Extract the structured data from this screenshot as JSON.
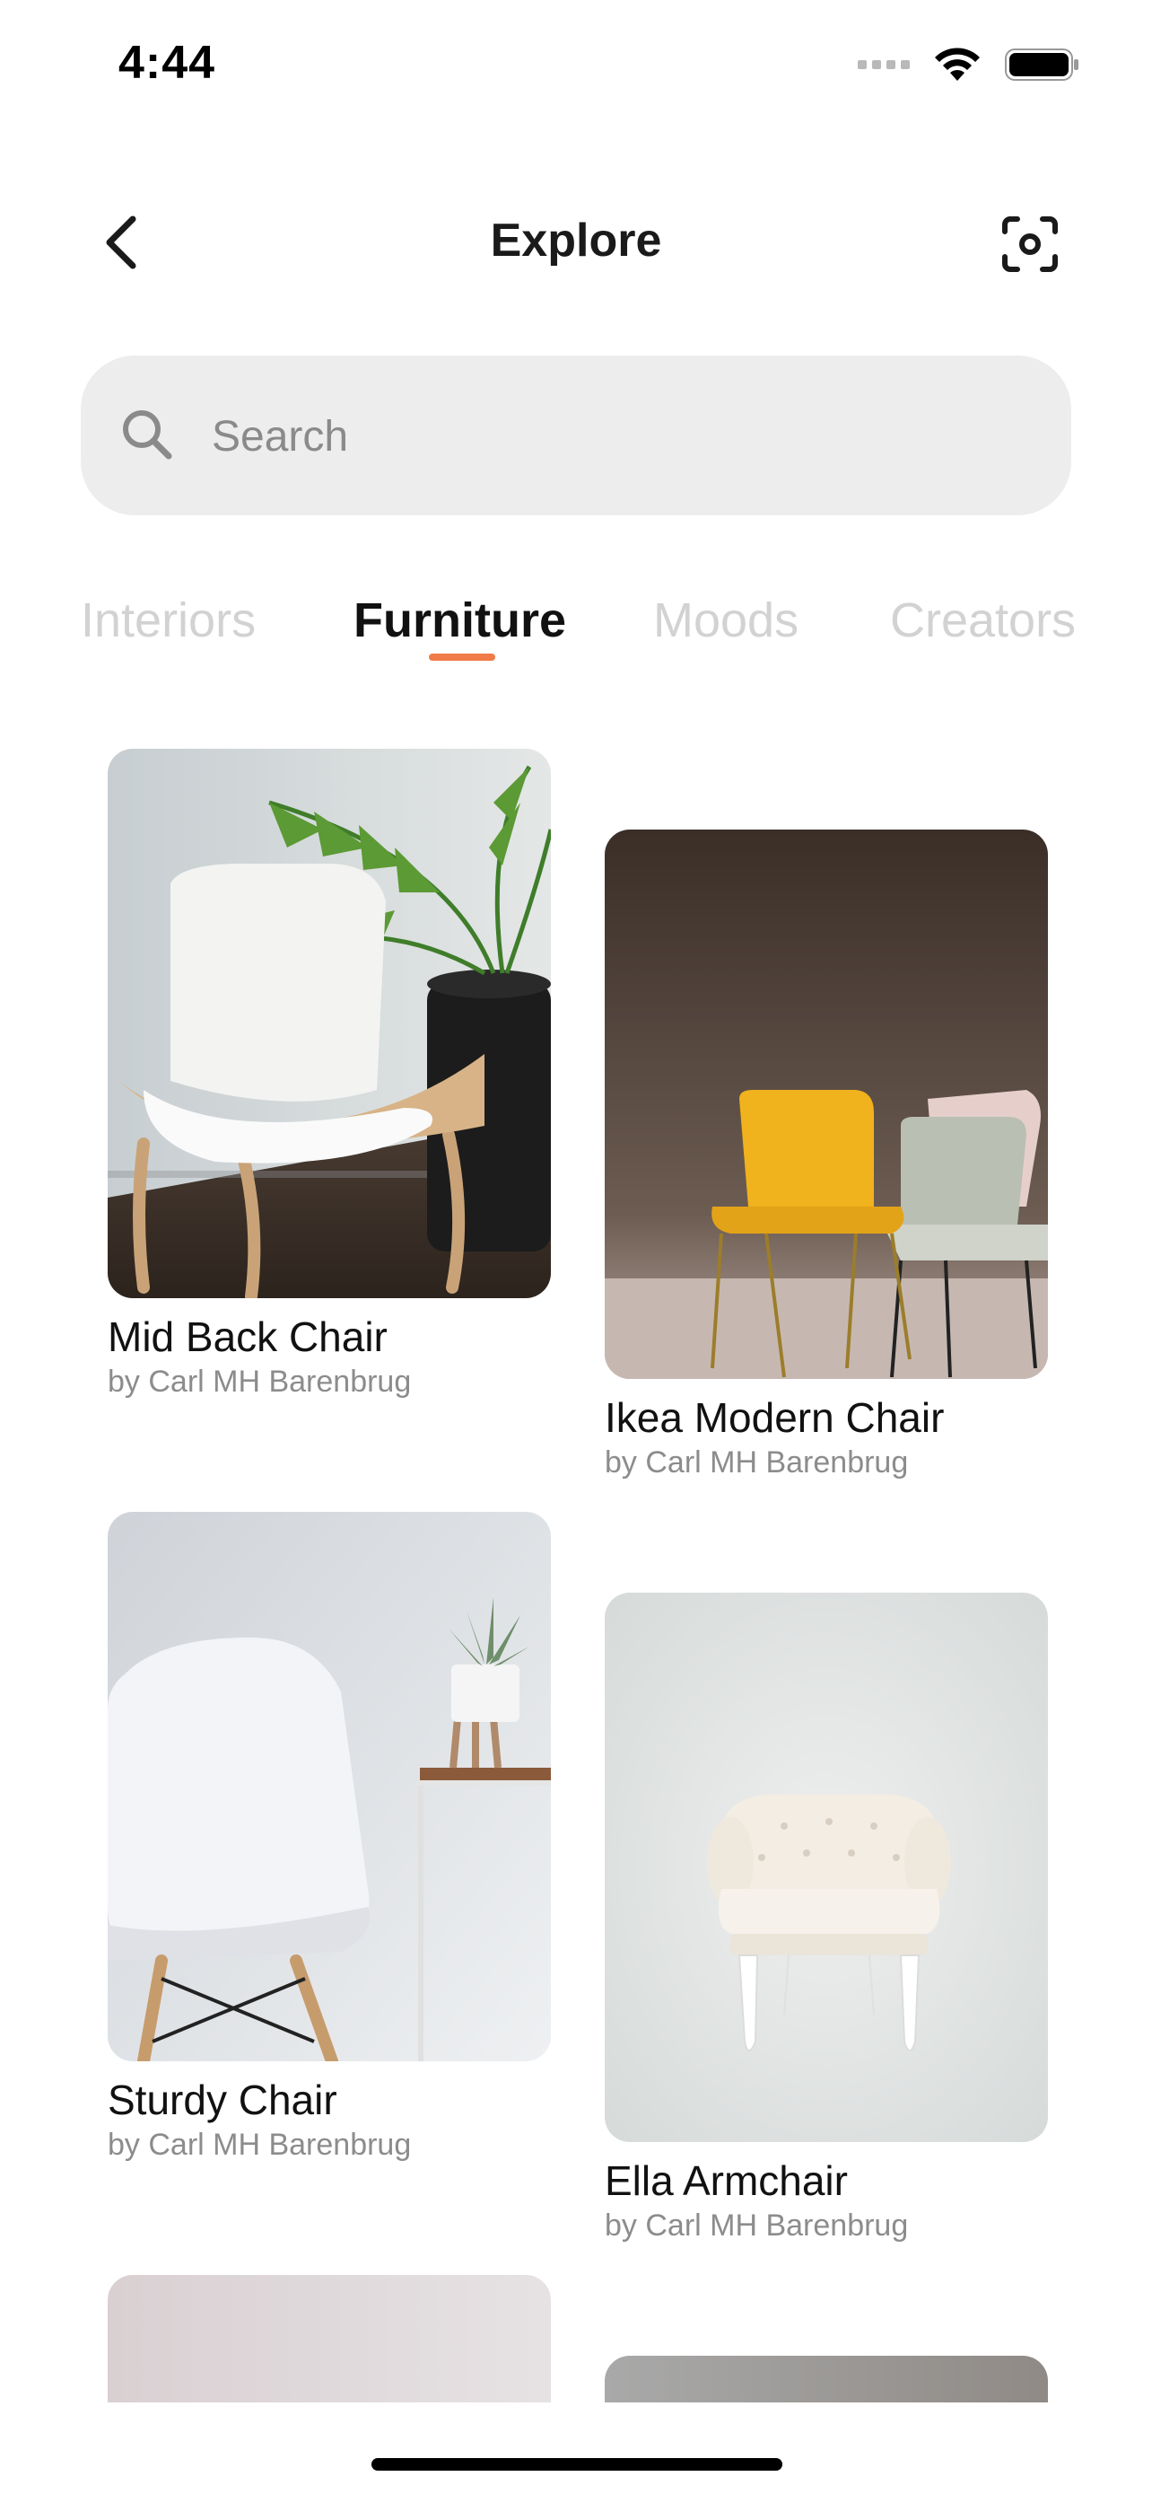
{
  "status_bar": {
    "time": "4:44",
    "icons": [
      "cellular-dots-icon",
      "wifi-icon",
      "battery-icon"
    ]
  },
  "header": {
    "title": "Explore",
    "back_icon": "chevron-left-icon",
    "scan_icon": "camera-scan-icon"
  },
  "search": {
    "placeholder": "Search",
    "value": "",
    "icon": "search-icon"
  },
  "tabs": [
    {
      "label": "Interiors",
      "active": false
    },
    {
      "label": "Furniture",
      "active": true
    },
    {
      "label": "Moods",
      "active": false
    },
    {
      "label": "Creators",
      "active": false
    }
  ],
  "accent_color": "#f07a48",
  "items": [
    {
      "title": "Mid Back Chair",
      "author": "by Carl MH Barenbrug"
    },
    {
      "title": "Ikea Modern Chair",
      "author": "by Carl MH Barenbrug"
    },
    {
      "title": "Sturdy Chair",
      "author": "by Carl MH Barenbrug"
    },
    {
      "title": "Ella Armchair",
      "author": "by Carl MH Barenbrug"
    }
  ]
}
